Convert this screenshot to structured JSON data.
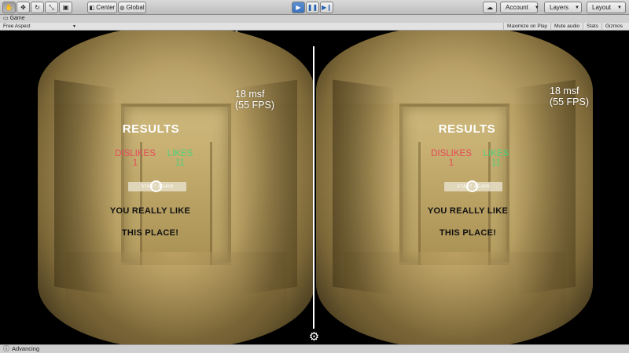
{
  "toolbar": {
    "pivot_label": "Center",
    "space_label": "Global",
    "account_label": "Account",
    "layers_label": "Layers",
    "layout_label": "Layout"
  },
  "tab": {
    "title": "Game"
  },
  "gamebar": {
    "aspect": "Free Aspect",
    "maximize": "Maximize on Play",
    "mute": "Mute audio",
    "stats": "Stats",
    "gizmos": "Gizmos"
  },
  "hud": {
    "fps_line1": "18 msf",
    "fps_line2": "(55 FPS)",
    "results_title": "RESULTS",
    "dislikes_label": "DISLIKES",
    "dislikes_count": "1",
    "likes_label": "LIKES",
    "likes_count": "11",
    "start_again": "START AGAIN",
    "message_line1": "YOU REALLY LIKE",
    "message_line2": "THIS PLACE!"
  },
  "status": {
    "text": "Advancing"
  },
  "colors": {
    "dislikes": "#e84a5a",
    "likes": "#4fd07a",
    "play_active": "#3b73bd"
  }
}
